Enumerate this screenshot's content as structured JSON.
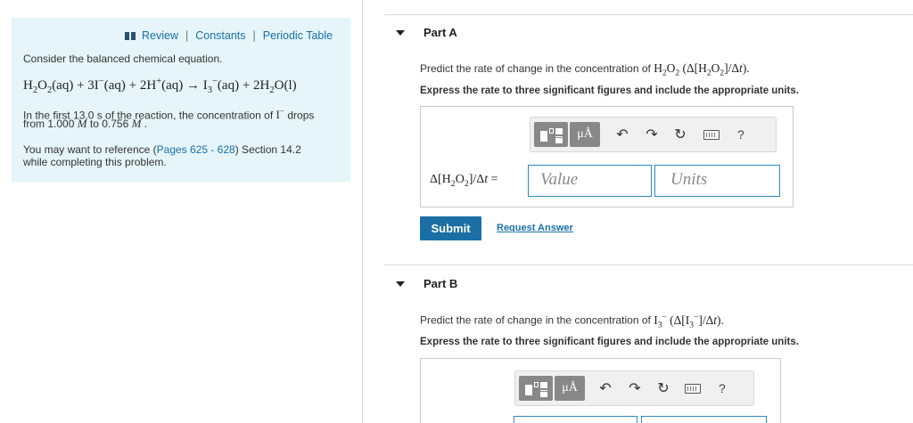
{
  "info_panel": {
    "links": {
      "review": "Review",
      "constants": "Constants",
      "periodic_table": "Periodic Table",
      "separator": "|"
    },
    "intro": "Consider the balanced chemical equation.",
    "conditions_1a": "In the first 13.0 s of the reaction, the concentration of",
    "conditions_1b": "drops",
    "conditions_2a": "from 1.000",
    "conditions_2b": "to 0.756",
    "reference_1a": "You may want to reference (",
    "reference_link": "Pages 625 - 628",
    "reference_1b": ") Section 14.2",
    "reference_2": "while completing this problem."
  },
  "part_a": {
    "title": "Part A",
    "prompt": "Predict the rate of change in the concentration of",
    "instruction": "Express the rate to three significant figures and include the appropriate units.",
    "value_placeholder": "Value",
    "units_placeholder": "Units",
    "submit_label": "Submit",
    "request_answer_label": "Request Answer"
  },
  "part_b": {
    "title": "Part B",
    "prompt": "Predict the rate of change in the concentration of",
    "instruction": "Express the rate to three significant figures and include the appropriate units."
  },
  "toolbar": {
    "units_label": "μÅ",
    "help_label": "?",
    "undo_icon": "undo-icon",
    "redo_icon": "redo-icon",
    "reset_icon": "reset-icon",
    "keyboard_icon": "keyboard-icon"
  },
  "colors": {
    "panel_bg": "#e5f5f9",
    "link": "#1a70a8",
    "submit_bg": "#1b6fa5",
    "field_border": "#2b8ac4"
  }
}
